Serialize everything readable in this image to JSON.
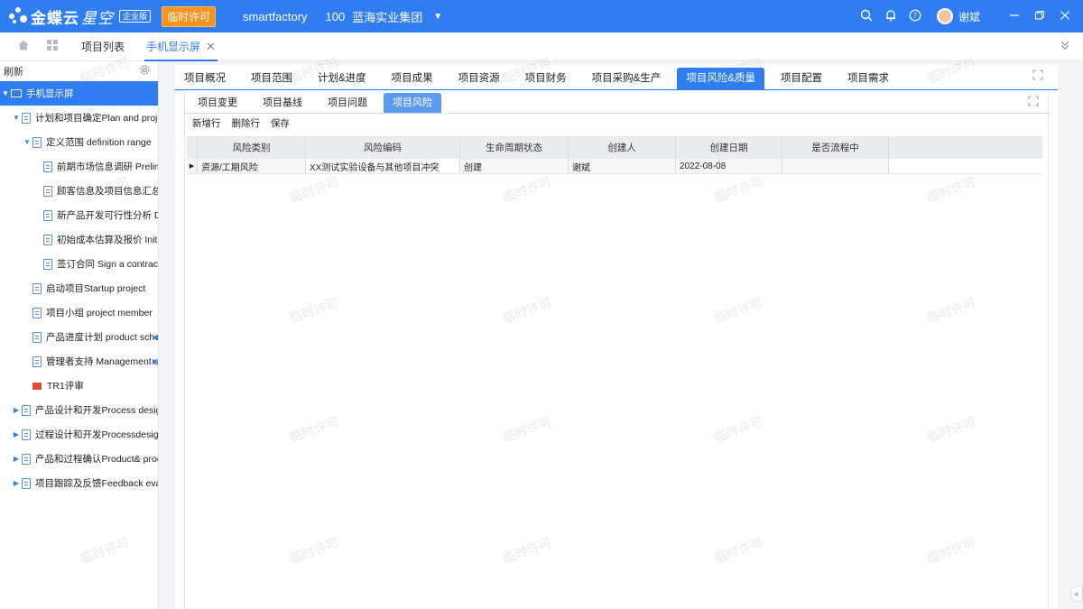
{
  "topbar": {
    "brand": "金蝶云",
    "brand_sub": "星空",
    "edition": "企业版",
    "license": "临时许可",
    "tenant": "smartfactory",
    "org_code": "100",
    "org_name": "蓝海实业集团",
    "user": "谢斌"
  },
  "page_tabs": [
    {
      "label": "项目列表"
    },
    {
      "label": "手机显示屏"
    }
  ],
  "sidebar": {
    "refresh": "刷新",
    "tree": [
      {
        "label": "手机显示屏"
      },
      {
        "label": "计划和项目确定Plan and proje"
      },
      {
        "label": "定义范围 definition range"
      },
      {
        "label": "前期市场信息调研 Prelim"
      },
      {
        "label": "顾客信息及项目信息汇总"
      },
      {
        "label": "新产品开发可行性分析  D"
      },
      {
        "label": "初始成本估算及报价  Initi"
      },
      {
        "label": "签订合同   Sign a contrac"
      },
      {
        "label": "启动项目Startup project"
      },
      {
        "label": "项目小组 project member"
      },
      {
        "label": "产品进度计划 product sche"
      },
      {
        "label": "管理者支持 Management s"
      },
      {
        "label": "TR1评审"
      },
      {
        "label": "产品设计和开发Process design"
      },
      {
        "label": "过程设计和开发Processdesign"
      },
      {
        "label": "产品和过程确认Product& proc"
      },
      {
        "label": "项目跟踪及反馈Feedback evalu"
      }
    ]
  },
  "main_tabs": [
    {
      "label": "项目概况"
    },
    {
      "label": "项目范围"
    },
    {
      "label": "计划&进度"
    },
    {
      "label": "项目成果"
    },
    {
      "label": "项目资源"
    },
    {
      "label": "项目财务"
    },
    {
      "label": "项目采购&生产"
    },
    {
      "label": "项目风险&质量"
    },
    {
      "label": "项目配置"
    },
    {
      "label": "项目需求"
    }
  ],
  "sub_tabs": [
    {
      "label": "项目变更"
    },
    {
      "label": "项目基线"
    },
    {
      "label": "项目问题"
    },
    {
      "label": "项目风险"
    }
  ],
  "toolbar": {
    "add_row": "新增行",
    "delete_row": "删除行",
    "save": "保存"
  },
  "grid": {
    "columns": [
      "风险类别",
      "风险编码",
      "生命周期状态",
      "创建人",
      "创建日期",
      "是否流程中"
    ],
    "rows": [
      [
        "资源/工期风险",
        "XX测试实验设备与其他项目冲突",
        "创建",
        "谢斌",
        "2022-08-08",
        ""
      ]
    ]
  },
  "watermark": "临时许可"
}
